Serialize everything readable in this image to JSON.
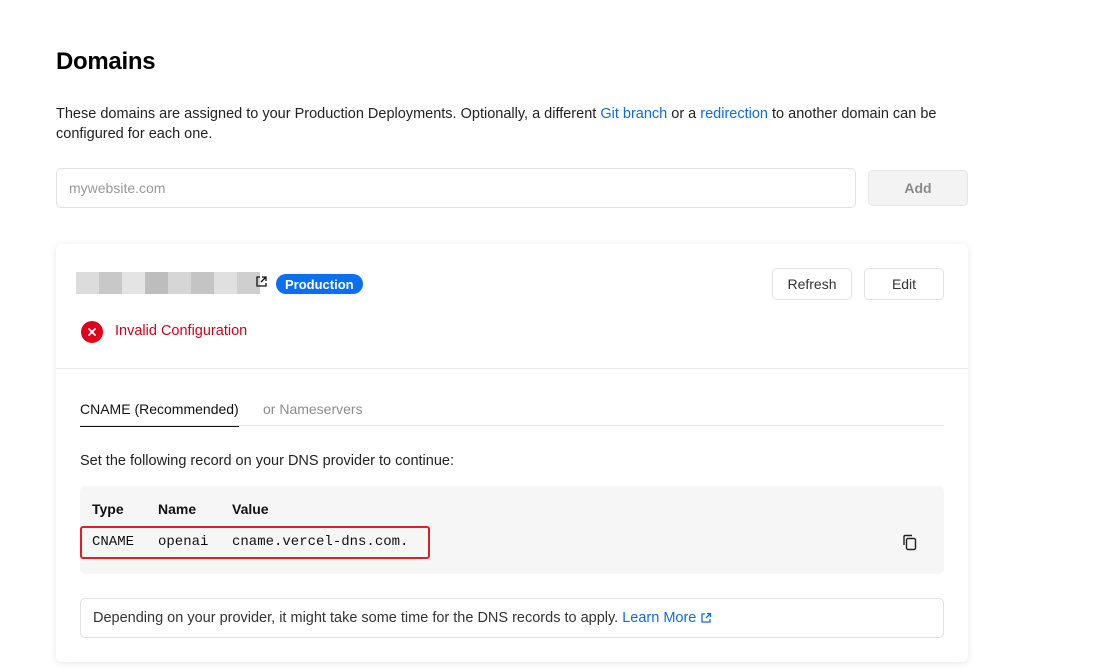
{
  "page": {
    "title": "Domains",
    "intro": {
      "part1": "These domains are assigned to your Production Deployments. Optionally, a different ",
      "git_link": "Git branch",
      "part2": " or a ",
      "redirect_link": "redirection",
      "part3": " to another domain can be configured for each one."
    }
  },
  "add_domain": {
    "placeholder": "mywebsite.com",
    "value": "",
    "button_label": "Add"
  },
  "domain_card": {
    "badge": "Production",
    "refresh_label": "Refresh",
    "edit_label": "Edit",
    "status_text": "Invalid Configuration",
    "tabs": [
      {
        "label": "CNAME (Recommended)",
        "active": true
      },
      {
        "label": "or Nameservers",
        "active": false
      }
    ],
    "instructions": "Set the following record on your DNS provider to continue:",
    "record": {
      "headers": [
        "Type",
        "Name",
        "Value"
      ],
      "row": [
        "CNAME",
        "openai",
        "cname.vercel-dns.com."
      ]
    },
    "note": {
      "text": "Depending on your provider, it might take some time for the DNS records to apply.",
      "link": "Learn More"
    }
  },
  "icons": {
    "status": "error-x-icon",
    "copy": "copy-icon",
    "external": "external-link-icon"
  },
  "colors": {
    "link": "#0a6fd8",
    "badge": "#0a70f0",
    "error": "#d0021b",
    "highlight_border": "#e02020"
  }
}
